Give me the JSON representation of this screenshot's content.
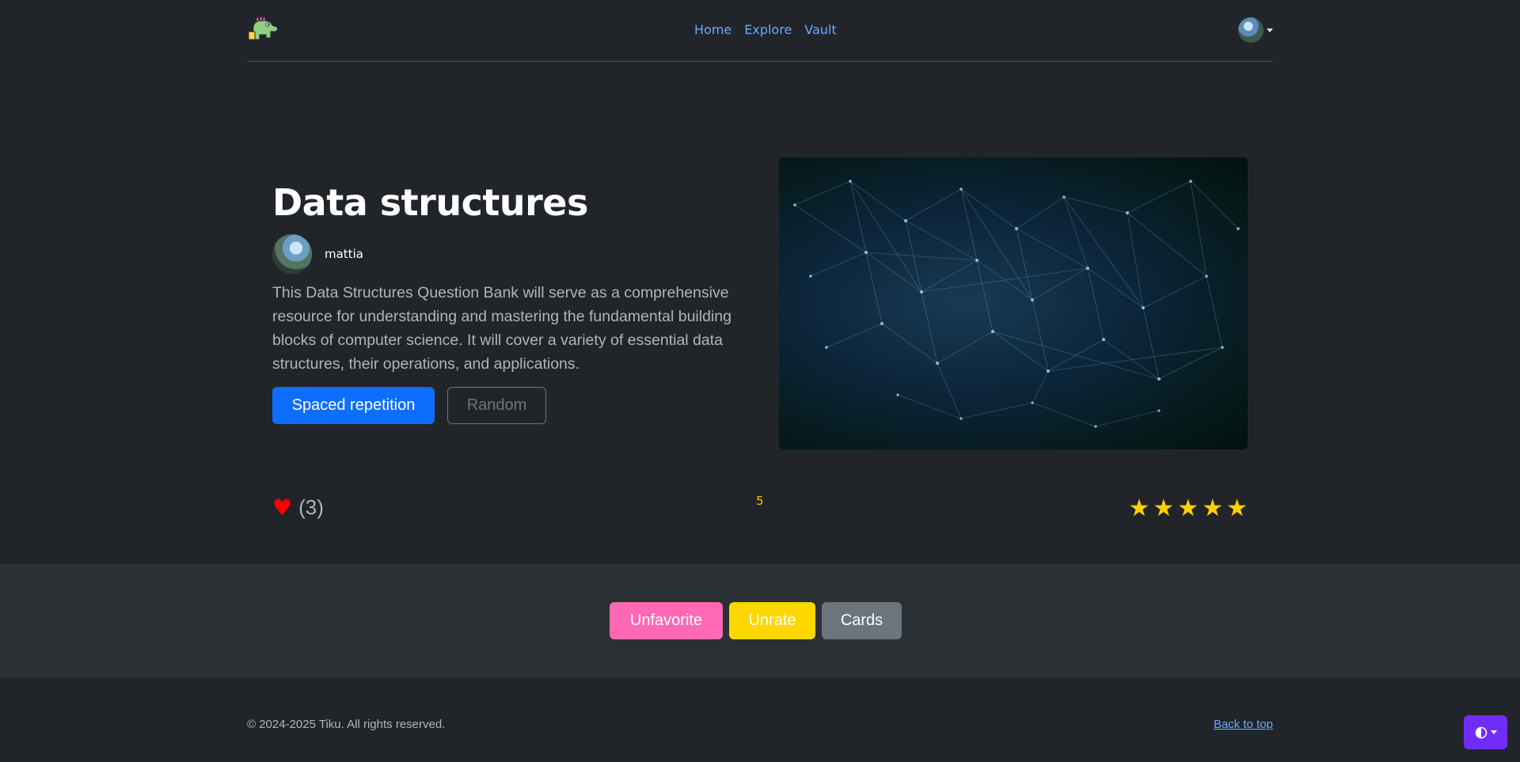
{
  "nav": {
    "logo_icon": "dinosaur-logo-icon",
    "links": [
      "Home",
      "Explore",
      "Vault"
    ],
    "avatar_icon": "user-avatar-icon",
    "link_color": "#6ea8fe"
  },
  "deck": {
    "title": "Data structures",
    "author": "mattia",
    "description": "This Data Structures Question Bank will serve as a comprehensive resource for understanding and mastering the fundamental building blocks of computer science. It will cover a variety of essential data structures, their operations, and applications.",
    "buttons": {
      "spaced_repetition": "Spaced repetition",
      "random": "Random"
    },
    "image_icon": "network-graph-image"
  },
  "stats": {
    "favorite_count": "(3)",
    "rating_value": "5",
    "stars": 5,
    "heart_color": "#ff0000",
    "star_color": "#ffd000"
  },
  "actions": {
    "unfavorite": "Unfavorite",
    "unrate": "Unrate",
    "cards": "Cards",
    "colors": {
      "unfavorite": "#ff69b4",
      "unrate": "#ffd700",
      "cards": "#6c757d"
    }
  },
  "footer": {
    "copyright": "© 2024-2025 Tiku. All rights reserved.",
    "back_to_top": "Back to top"
  },
  "theme_toggle": {
    "icon": "contrast-half-circle-icon",
    "color": "#712cf9"
  }
}
